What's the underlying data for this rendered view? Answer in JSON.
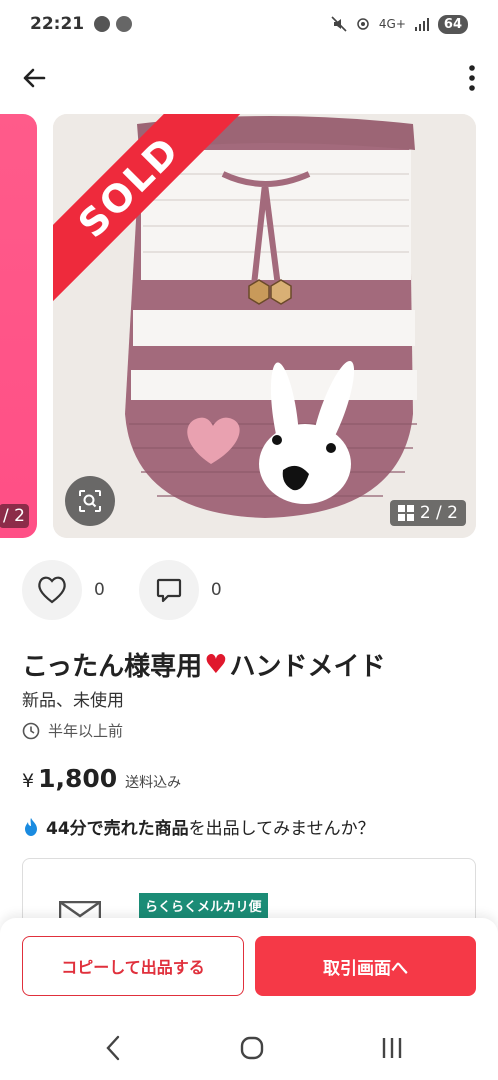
{
  "status_bar": {
    "time": "22:21",
    "network": "4G+",
    "battery": "64"
  },
  "gallery": {
    "prev_counter": "/ 2",
    "sold_label": "SOLD",
    "counter": "2 / 2"
  },
  "actions": {
    "likes": "0",
    "comments": "0"
  },
  "item": {
    "title_before": "こったん様専用",
    "title_heart": "♥",
    "title_after": "ハンドメイド",
    "condition": "新品、未使用",
    "posted": "半年以上前",
    "currency": "¥",
    "price": "1,800",
    "shipping": "送料込み"
  },
  "promo": {
    "bold": "44分で売れた商品",
    "rest": "を出品してみませんか？"
  },
  "shipping_card": {
    "method": "らくらくメルカリ便"
  },
  "buttons": {
    "copy": "コピーして出品する",
    "trade": "取引画面へ"
  },
  "colors": {
    "accent": "#f53947",
    "sold": "#ee2a3c",
    "shipping_badge": "#1b8c76"
  }
}
